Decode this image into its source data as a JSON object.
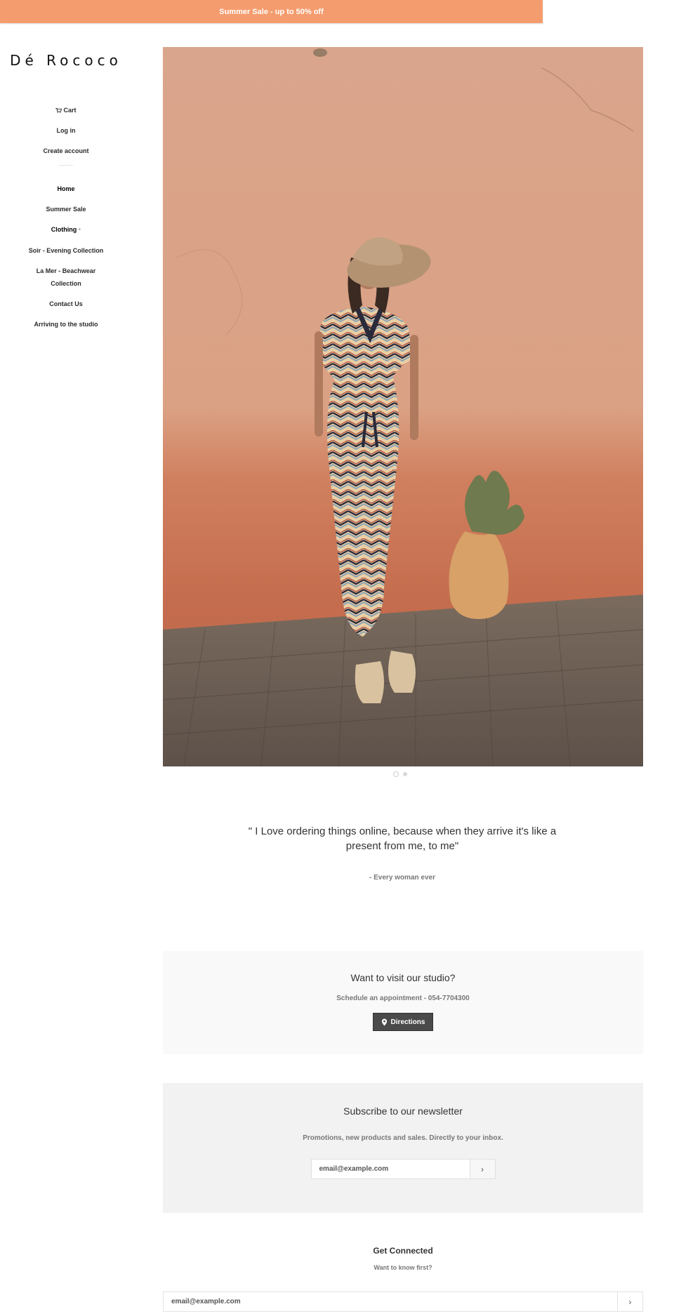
{
  "announcement": {
    "text": "Summer Sale - up to 50% off"
  },
  "brand": {
    "logo": "Dé Rococo"
  },
  "account_nav": {
    "cart": "Cart",
    "login": "Log in",
    "create": "Create account"
  },
  "main_nav": {
    "items": [
      {
        "label": "Home"
      },
      {
        "label": "Summer Sale"
      },
      {
        "label": "Clothing"
      },
      {
        "label": "Soir - Evening Collection"
      },
      {
        "label": "La Mer - Beachwear Collection"
      },
      {
        "label": "Contact Us"
      },
      {
        "label": "Arriving to the studio"
      }
    ],
    "expand_symbol": "+"
  },
  "slideshow": {
    "slide_count": 2,
    "active_slide": 1
  },
  "testimonial": {
    "quote": "\" I Love ordering things online, because when they arrive it's like a present from me, to me\"",
    "author": "- Every woman ever"
  },
  "studio": {
    "title": "Want to visit our studio?",
    "subtitle": "Schedule an appointment - 054-7704300",
    "button": "Directions"
  },
  "newsletter": {
    "title": "Subscribe to our newsletter",
    "subtitle": "Promotions, new products and sales. Directly to your inbox.",
    "placeholder": "email@example.com",
    "submit": "›"
  },
  "footer": {
    "title": "Get Connected",
    "subtitle": "Want to know first?",
    "placeholder": "email@example.com",
    "submit": "›"
  },
  "colors": {
    "announcement_bg": "#f59c6e",
    "button_dark": "#4a4a4a",
    "studio_bg": "#f9f9f9",
    "newsletter_bg": "#f2f2f2"
  }
}
